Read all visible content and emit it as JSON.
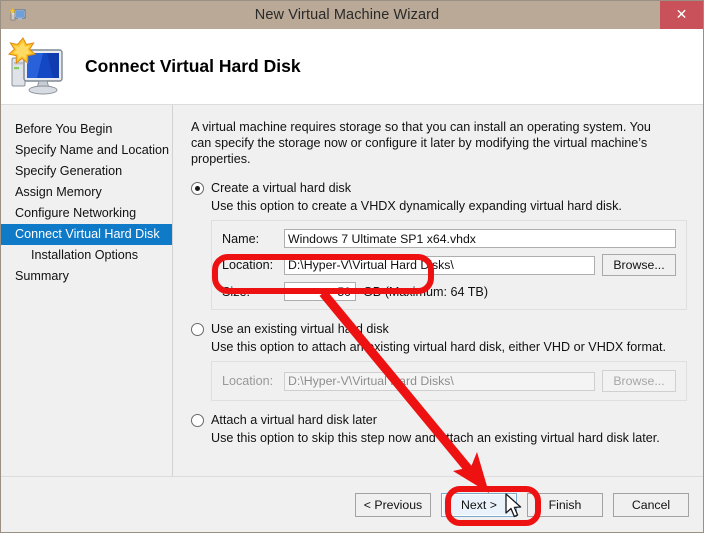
{
  "window": {
    "title": "New Virtual Machine Wizard",
    "close_label": "✕",
    "titlebar_color": "#b9a996",
    "close_color": "#c9515a"
  },
  "header": {
    "title": "Connect Virtual Hard Disk",
    "icon": "virtual-machine-monitor-icon"
  },
  "sidebar": {
    "items": [
      {
        "label": "Before You Begin",
        "selected": false,
        "indent": false
      },
      {
        "label": "Specify Name and Location",
        "selected": false,
        "indent": false
      },
      {
        "label": "Specify Generation",
        "selected": false,
        "indent": false
      },
      {
        "label": "Assign Memory",
        "selected": false,
        "indent": false
      },
      {
        "label": "Configure Networking",
        "selected": false,
        "indent": false
      },
      {
        "label": "Connect Virtual Hard Disk",
        "selected": true,
        "indent": false
      },
      {
        "label": "Installation Options",
        "selected": false,
        "indent": true
      },
      {
        "label": "Summary",
        "selected": false,
        "indent": false
      }
    ],
    "selected_color": "#0f7ac7"
  },
  "main": {
    "intro": "A virtual machine requires storage so that you can install an operating system. You can specify the storage now or configure it later by modifying the virtual machine’s properties.",
    "options": [
      {
        "label": "Create a virtual hard disk",
        "description": "Use this option to create a VHDX dynamically expanding virtual hard disk.",
        "selected": true
      },
      {
        "label": "Use an existing virtual hard disk",
        "description": "Use this option to attach an existing virtual hard disk, either VHD or VHDX format.",
        "selected": false
      },
      {
        "label": "Attach a virtual hard disk later",
        "description": "Use this option to skip this step now and attach an existing virtual hard disk later.",
        "selected": false
      }
    ],
    "create_group": {
      "name_label": "Name:",
      "name_value": "Windows 7 Ultimate SP1 x64.vhdx",
      "location_label": "Location:",
      "location_value": "D:\\Hyper-V\\Virtual Hard Disks\\",
      "browse_label": "Browse...",
      "size_label": "Size:",
      "size_value": "50",
      "size_suffix": "GB (Maximum: 64 TB)"
    },
    "existing_group": {
      "location_label": "Location:",
      "location_value": "D:\\Hyper-V\\Virtual Hard Disks\\",
      "browse_label": "Browse..."
    }
  },
  "footer": {
    "previous_label": "< Previous",
    "next_label": "Next >",
    "finish_label": "Finish",
    "cancel_label": "Cancel"
  },
  "annotations": {
    "highlight_color": "#ee1111",
    "size_box_highlight": "rounded rectangle around Size field",
    "next_button_highlight": "rounded rectangle around Next button",
    "arrow": "red arrow from Size field to Next button"
  }
}
